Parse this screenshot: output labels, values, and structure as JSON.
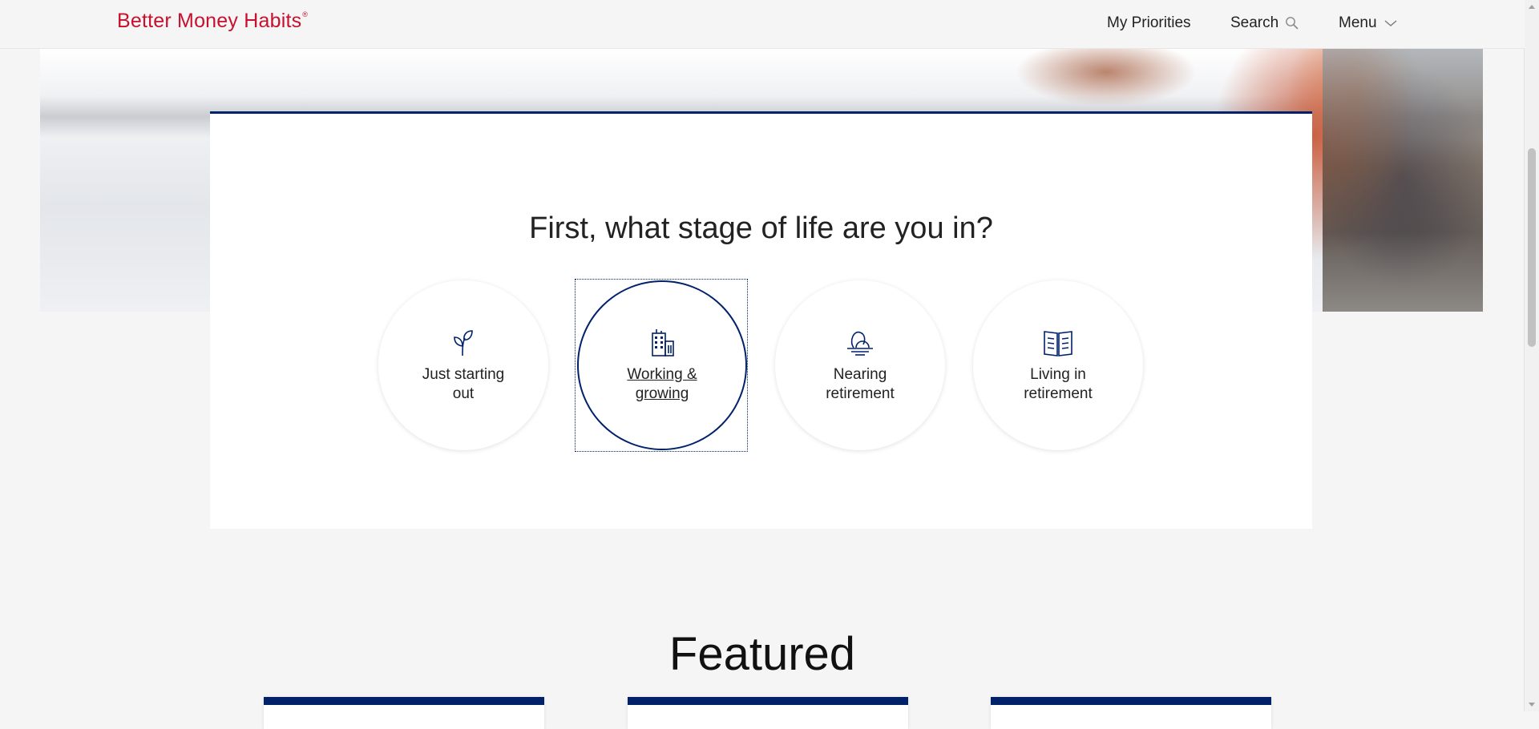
{
  "header": {
    "logo_text": "Better Money Habits",
    "logo_mark": "®",
    "nav": {
      "priorities": "My Priorities",
      "search": "Search",
      "menu": "Menu"
    }
  },
  "stage": {
    "title": "First, what stage of life are you in?",
    "options": [
      {
        "label": "Just starting out",
        "icon": "sprout-icon",
        "selected": false
      },
      {
        "label": "Working & growing",
        "icon": "building-icon",
        "selected": true
      },
      {
        "label": "Nearing retirement",
        "icon": "sunset-icon",
        "selected": false
      },
      {
        "label": "Living in retirement",
        "icon": "open-book-icon",
        "selected": false
      }
    ]
  },
  "featured": {
    "title": "Featured"
  },
  "colors": {
    "brand_red": "#c8102e",
    "navy": "#012169",
    "background": "#f5f5f5"
  }
}
